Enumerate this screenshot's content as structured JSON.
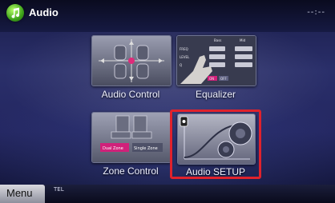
{
  "header": {
    "title": "Audio",
    "clock": "--:--",
    "app_icon": "audio-note-icon"
  },
  "tiles": {
    "audio_control": {
      "label": "Audio Control",
      "icon": "car-seat-balance-icon"
    },
    "equalizer": {
      "label": "Equalizer",
      "icon": "equalizer-panel-icon",
      "col_bass": "Bass",
      "col_mid": "Mid",
      "row_freq": "FREQ",
      "row_level": "LEVEL",
      "row_q": "Q",
      "on": "ON",
      "off": "OFF"
    },
    "zone_control": {
      "label": "Zone Control",
      "icon": "seats-icon",
      "dual_zone": "Dual Zone",
      "single_zone": "Single Zone"
    },
    "audio_setup": {
      "label": "Audio SETUP",
      "icon": "speaker-setup-icon",
      "selected": true
    }
  },
  "footer": {
    "menu_label": "Menu",
    "tel_label": "TEL"
  },
  "colors": {
    "highlight": "#e0222c",
    "accent_pink": "#d0217a"
  }
}
